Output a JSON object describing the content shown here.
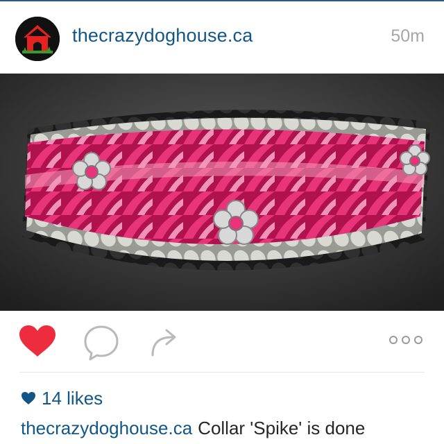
{
  "post": {
    "username": "thecrazydoghouse.ca",
    "time_ago": "50m",
    "likes": "14 likes",
    "caption": {
      "username": "thecrazydoghouse.ca",
      "text": "Collar 'Spike' is done"
    }
  },
  "icons": {
    "avatar": "red-doghouse-logo",
    "like": "heart-icon",
    "comment": "speech-bubble-icon",
    "share": "share-arrow-icon",
    "more": "ellipsis-icon",
    "likes_heart": "small-heart-icon"
  },
  "colors": {
    "accent": "#125688",
    "like_red": "#ED2D3E",
    "timestamp_gray": "#A6A6A6"
  }
}
